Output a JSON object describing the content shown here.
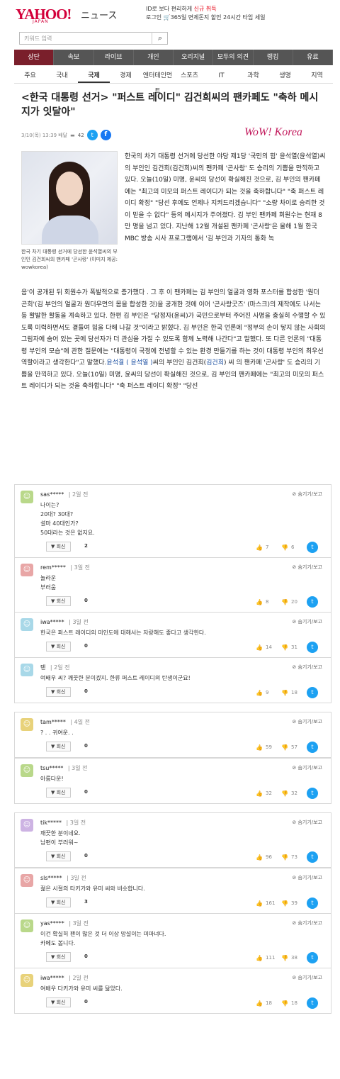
{
  "header": {
    "logo": "YAHOO!",
    "logo_sub": "JAPAN",
    "section": "ニュース",
    "promo_line1_a": "ID로 보다 편리하게",
    "promo_line1_b": "신규 취득",
    "promo_line2_a": "로그인",
    "promo_line2_b": "365일 면제돈지 할인 24시간 타임 세일"
  },
  "search": {
    "placeholder": "키워드 입력"
  },
  "nav_main": [
    "상단",
    "속보",
    "라이브",
    "개인",
    "오리지널",
    "모두의 의견",
    "랭킹",
    "유료"
  ],
  "nav_sub": [
    "주요",
    "국내",
    "국제",
    "경제",
    "엔터테인먼트",
    "스포츠",
    "IT",
    "과학",
    "생명",
    "지역"
  ],
  "article": {
    "title": "<한국 대통령 선거> \"퍼스트 레이디\" 김건희씨의 팬카페도 \"축하 메시지가 잇달아\"",
    "date": "3/10(목) 13:39 배달",
    "comment_count": "42",
    "source_logo": "WoW! Korea",
    "caption": "한국 차기 대통령 선거에 당선한 윤석열씨의 부인인 김건희씨의 팬카페 '곤사랑' (이미지 제공: wowkorea)",
    "body_top": "한국의 차기 대통령 선거에 당선한 야당 제1당 '국민의 힘' 윤석열(윤석열)씨의 부인인 김건희(김건희)씨의 팬카페 '곤사랑' 도 승리의 기쁨을 만끽하고 있다. 오늘(10일) 미명, 윤씨의 당선이 확실해진 것으로, 김 부인의 팬카페에는 \"최고의 미모의 퍼스트 레이디가 되는 것을 축하합니다\" \"축 퍼스트 레이디 확정\" \"당선 후에도 언제나 지켜드리겠습니다\" \"소량 차이로 승리한 것이 믿을 수 없다\" 등의 메시지가 주어졌다. 김 부인 팬카페 회원수는 현재 8만 명을 넘고 있다. 지난해 12월 개설된 팬카페 '곤사랑'은 올해 1월 한국 MBC 방송 시사 프로그램에서 '김 부인과 기자의 통화 녹",
    "body_a": "음'이 공개된 뒤 회원수가 폭발적으로 증가했다 . 그 후 이 팬카페는 김 부인의 얼굴과 영화 포스터를 합성한 '원더 곤희'(김 부인의 얼굴과 원더우먼의 몸을 합성한 것)을 공개한 것에 이어 '곤사랑굿즈' (마스크)의 제작에도 나서는 등 활발한 활동을 계속하고 있다. 한편 김 부인은 \"당정자(윤씨)가 국민으로부터 주어진 사명을 충실히 수행할 수 있도록 미력하면서도 곁들여 힘을 다해 나갈 것\"이라고 밝혔다. 김 부인은 한국 언론에 \"정부의 손이 닿지 않는 사회의 그림자에 숨어 있는 곳에 당선자가 더 관심을 가질 수 있도록 함께 노력해 나간다\"고 말했다. 또 다른 언론의 \"대통령 부인의 모습\"에 관한 질문에는 \"대통령이 국정에 전념할 수 있는 환경 만들기를 하는 것이 대통령 부인의 최우선 역할이라고 생각한다\"고 말했다.",
    "body_link1": "윤석결 ( 윤석열 )",
    "body_b": "씨의 부인인 김건희(",
    "body_link2": "김건희",
    "body_c": ") 씨 의 팬카페 '곤사랑' 도 승리의 기쁨을 만끽하고 있다. 오늘(10일) 미명, 윤씨의 당선이 확실해진 것으로, 김 부인의 팬카페에는 \"최고의 미모의 퍼스트 레이디가 되는 것을 축하합니다\" \"축 퍼스트 레이디 확정\" \"당선"
  },
  "ui": {
    "reply_label": "▼ 회신",
    "hide_label": "숨기기/보고"
  },
  "comments": [
    {
      "user": "sas*****",
      "time": "2일 전",
      "lines": [
        "나이는?",
        "20대? 30대?",
        "설마 40대인가?",
        "50대라는 것은 없지요."
      ],
      "replies": "2",
      "up": "7",
      "down": "6",
      "color": "#b9d88a"
    },
    {
      "user": "rem*****",
      "time": "3일 전",
      "lines": [
        "놀라운",
        "부러움"
      ],
      "replies": "0",
      "up": "8",
      "down": "20",
      "color": "#e8a6a6"
    },
    {
      "user": "iwa*****",
      "time": "3일 전",
      "lines": [
        "한국은 퍼스트 레이디의 미인도에 대해서는 자랑해도 좋다고 생각한다."
      ],
      "replies": "0",
      "up": "14",
      "down": "31",
      "color": "#a8d8e8"
    },
    {
      "user": "텐",
      "time": "2일 전",
      "lines": [
        "여배우 씨? 깨끗한 분이겠지. 한류 퍼스트 레이디의 탄생이군요!"
      ],
      "replies": "0",
      "up": "9",
      "down": "18",
      "color": "#a8d8e8"
    },
    {
      "user": "tam*****",
      "time": "4일 전",
      "lines": [
        "? . . 귀여운. ."
      ],
      "replies": "0",
      "up": "59",
      "down": "57",
      "color": "#e8d27a"
    },
    {
      "user": "tsu*****",
      "time": "3일 전",
      "lines": [
        "아름다운!"
      ],
      "replies": "0",
      "up": "32",
      "down": "32",
      "color": "#b9d88a"
    },
    {
      "user": "tik*****",
      "time": "3일 전",
      "lines": [
        "깨끗한 분이네요.",
        "남편이 부러워~"
      ],
      "replies": "0",
      "up": "96",
      "down": "73",
      "color": "#cdb3e3"
    },
    {
      "user": "sls*****",
      "time": "3일 전",
      "lines": [
        "젊은 시절의 타키가와 유미 씨와 비슷합니다."
      ],
      "replies": "3",
      "up": "161",
      "down": "39",
      "color": "#e8a6a6"
    },
    {
      "user": "yas*****",
      "time": "3일 전",
      "lines": [
        "이건 확실히 팬이 많은 것 더 이상 망설이는 미마녀다.",
        "",
        "카페도 봅니다."
      ],
      "replies": "0",
      "up": "111",
      "down": "38",
      "color": "#b9d88a"
    },
    {
      "user": "iwa*****",
      "time": "2일 전",
      "lines": [
        "여배우 다키가와 유미 씨를 닮았다."
      ],
      "replies": "0",
      "up": "18",
      "down": "18",
      "color": "#e8d27a"
    }
  ]
}
